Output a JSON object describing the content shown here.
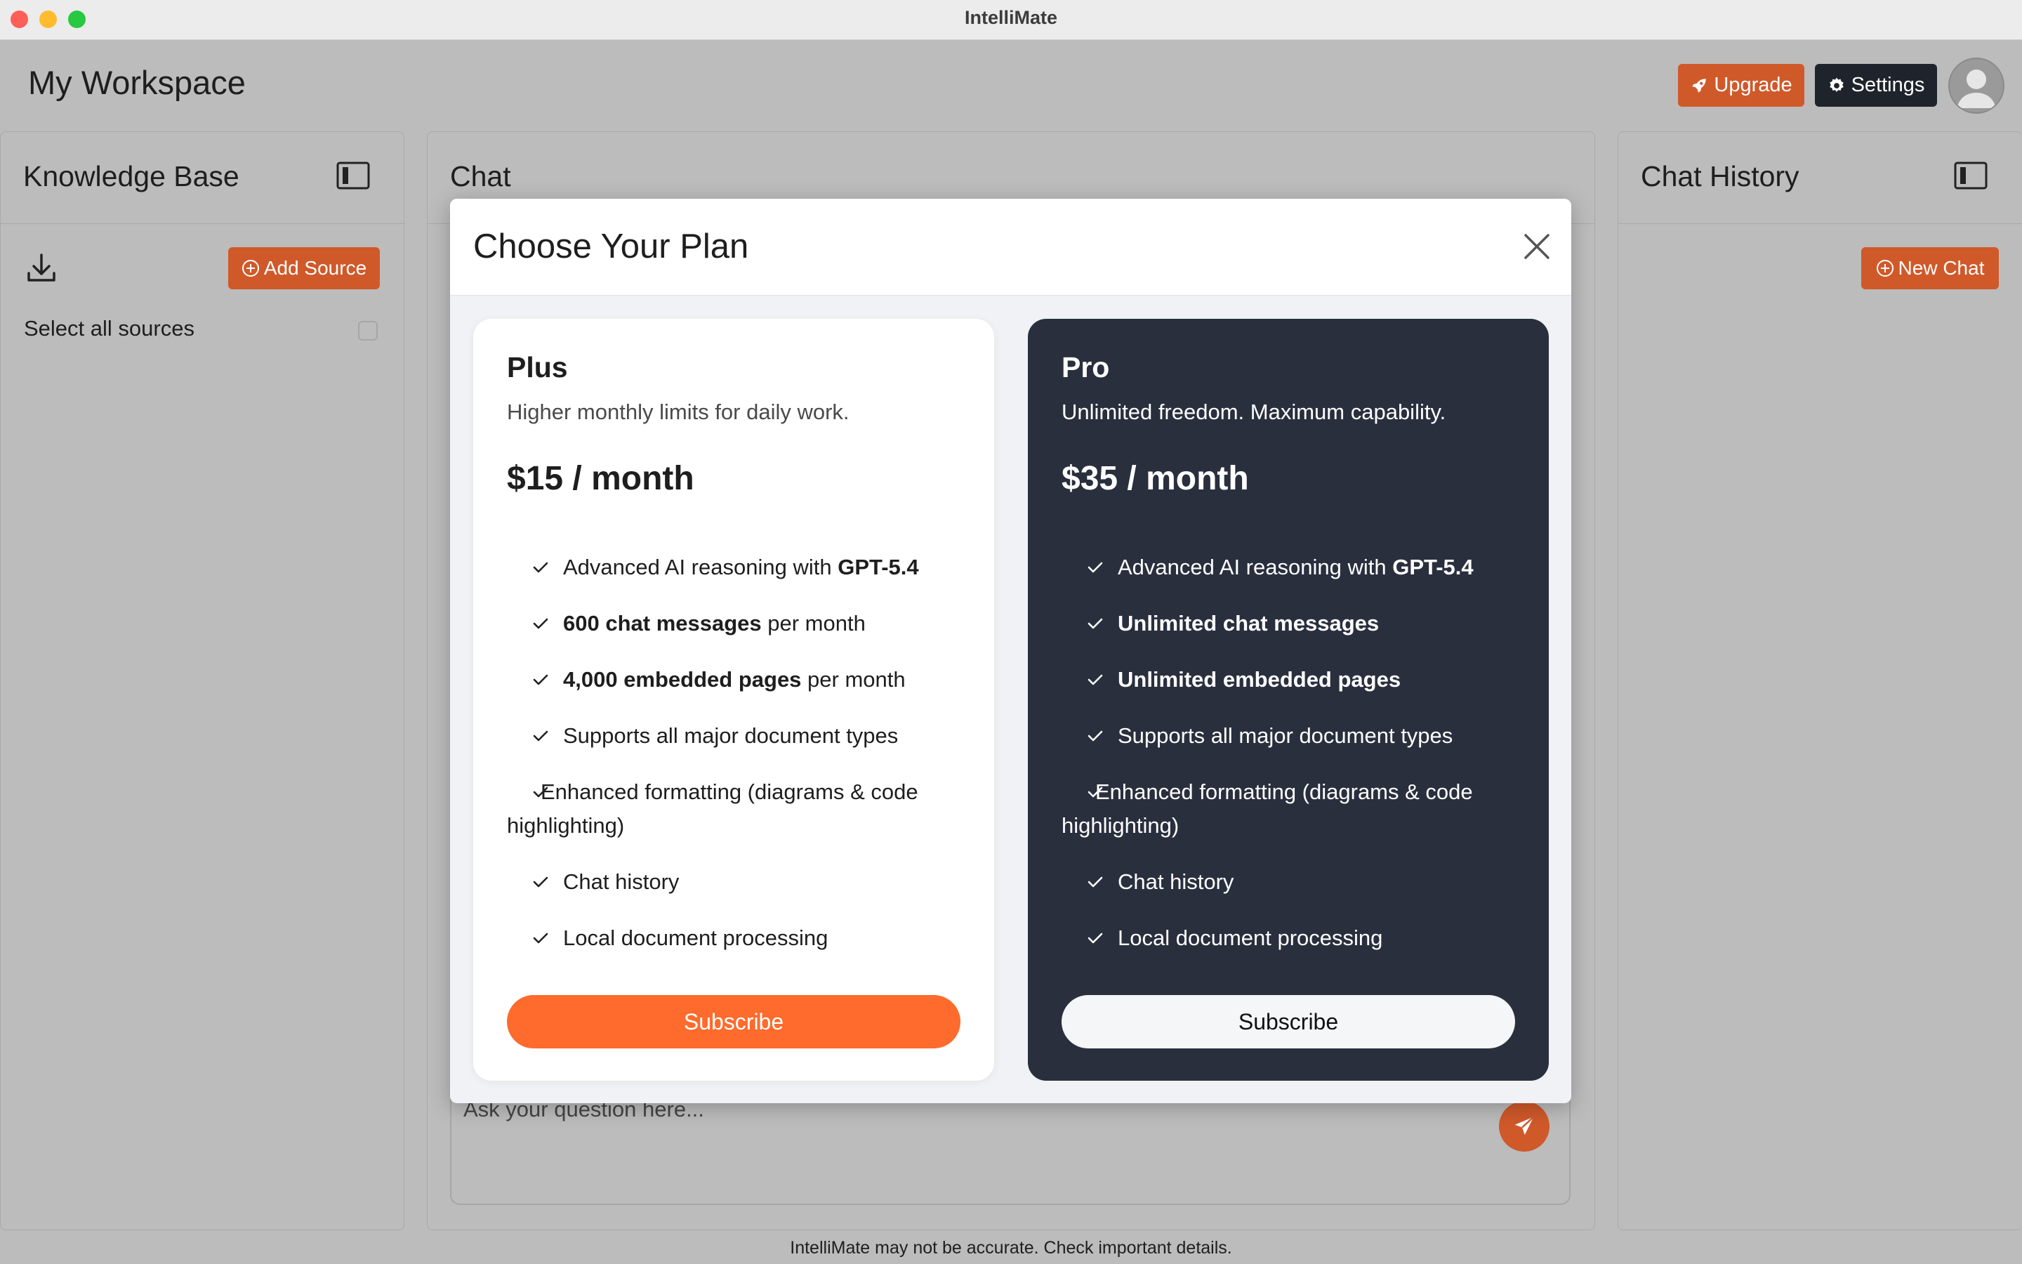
{
  "window": {
    "title": "IntelliMate"
  },
  "header": {
    "workspace_title": "My Workspace",
    "upgrade_label": "Upgrade",
    "settings_label": "Settings"
  },
  "knowledge_base": {
    "title": "Knowledge Base",
    "add_source_label": "Add Source",
    "select_all_label": "Select all sources"
  },
  "chat": {
    "title": "Chat",
    "placeholder": "Ask your question here..."
  },
  "chat_history": {
    "title": "Chat History",
    "new_chat_label": "New Chat"
  },
  "footer": {
    "note": "IntelliMate may not be accurate. Check important details."
  },
  "modal": {
    "title": "Choose Your Plan",
    "plans": [
      {
        "name": "Plus",
        "description": "Higher monthly limits for daily work.",
        "price": "$15 / month",
        "subscribe_label": "Subscribe",
        "features": [
          {
            "pre": "Advanced AI reasoning with ",
            "bold": "GPT-5.4",
            "post": ""
          },
          {
            "pre": "",
            "bold": "600 chat messages",
            "post": " per month"
          },
          {
            "pre": "",
            "bold": "4,000 embedded pages",
            "post": " per month"
          },
          {
            "pre": "Supports all major document types",
            "bold": "",
            "post": ""
          },
          {
            "pre": "Enhanced formatting (diagrams & code highlighting)",
            "bold": "",
            "post": ""
          },
          {
            "pre": "Chat history",
            "bold": "",
            "post": ""
          },
          {
            "pre": "Local document processing",
            "bold": "",
            "post": ""
          }
        ]
      },
      {
        "name": "Pro",
        "description": "Unlimited freedom. Maximum capability.",
        "price": "$35 / month",
        "subscribe_label": "Subscribe",
        "features": [
          {
            "pre": "Advanced AI reasoning with ",
            "bold": "GPT-5.4",
            "post": ""
          },
          {
            "pre": "",
            "bold": "Unlimited chat messages",
            "post": ""
          },
          {
            "pre": "",
            "bold": "Unlimited embedded pages",
            "post": ""
          },
          {
            "pre": "Supports all major document types",
            "bold": "",
            "post": ""
          },
          {
            "pre": "Enhanced formatting (diagrams & code highlighting)",
            "bold": "",
            "post": ""
          },
          {
            "pre": "Chat history",
            "bold": "",
            "post": ""
          },
          {
            "pre": "Local document processing",
            "bold": "",
            "post": ""
          }
        ]
      }
    ]
  },
  "colors": {
    "accent": "#d0592a",
    "subscribe_plus": "#fe6b2c",
    "pro_card": "#2a2f3e",
    "settings_button": "#1f242c"
  },
  "icons": [
    "rocket-icon",
    "gear-icon",
    "user-avatar-icon",
    "sidebar-toggle-icon",
    "download-icon",
    "plus-circle-icon",
    "close-icon",
    "check-icon",
    "send-icon"
  ]
}
